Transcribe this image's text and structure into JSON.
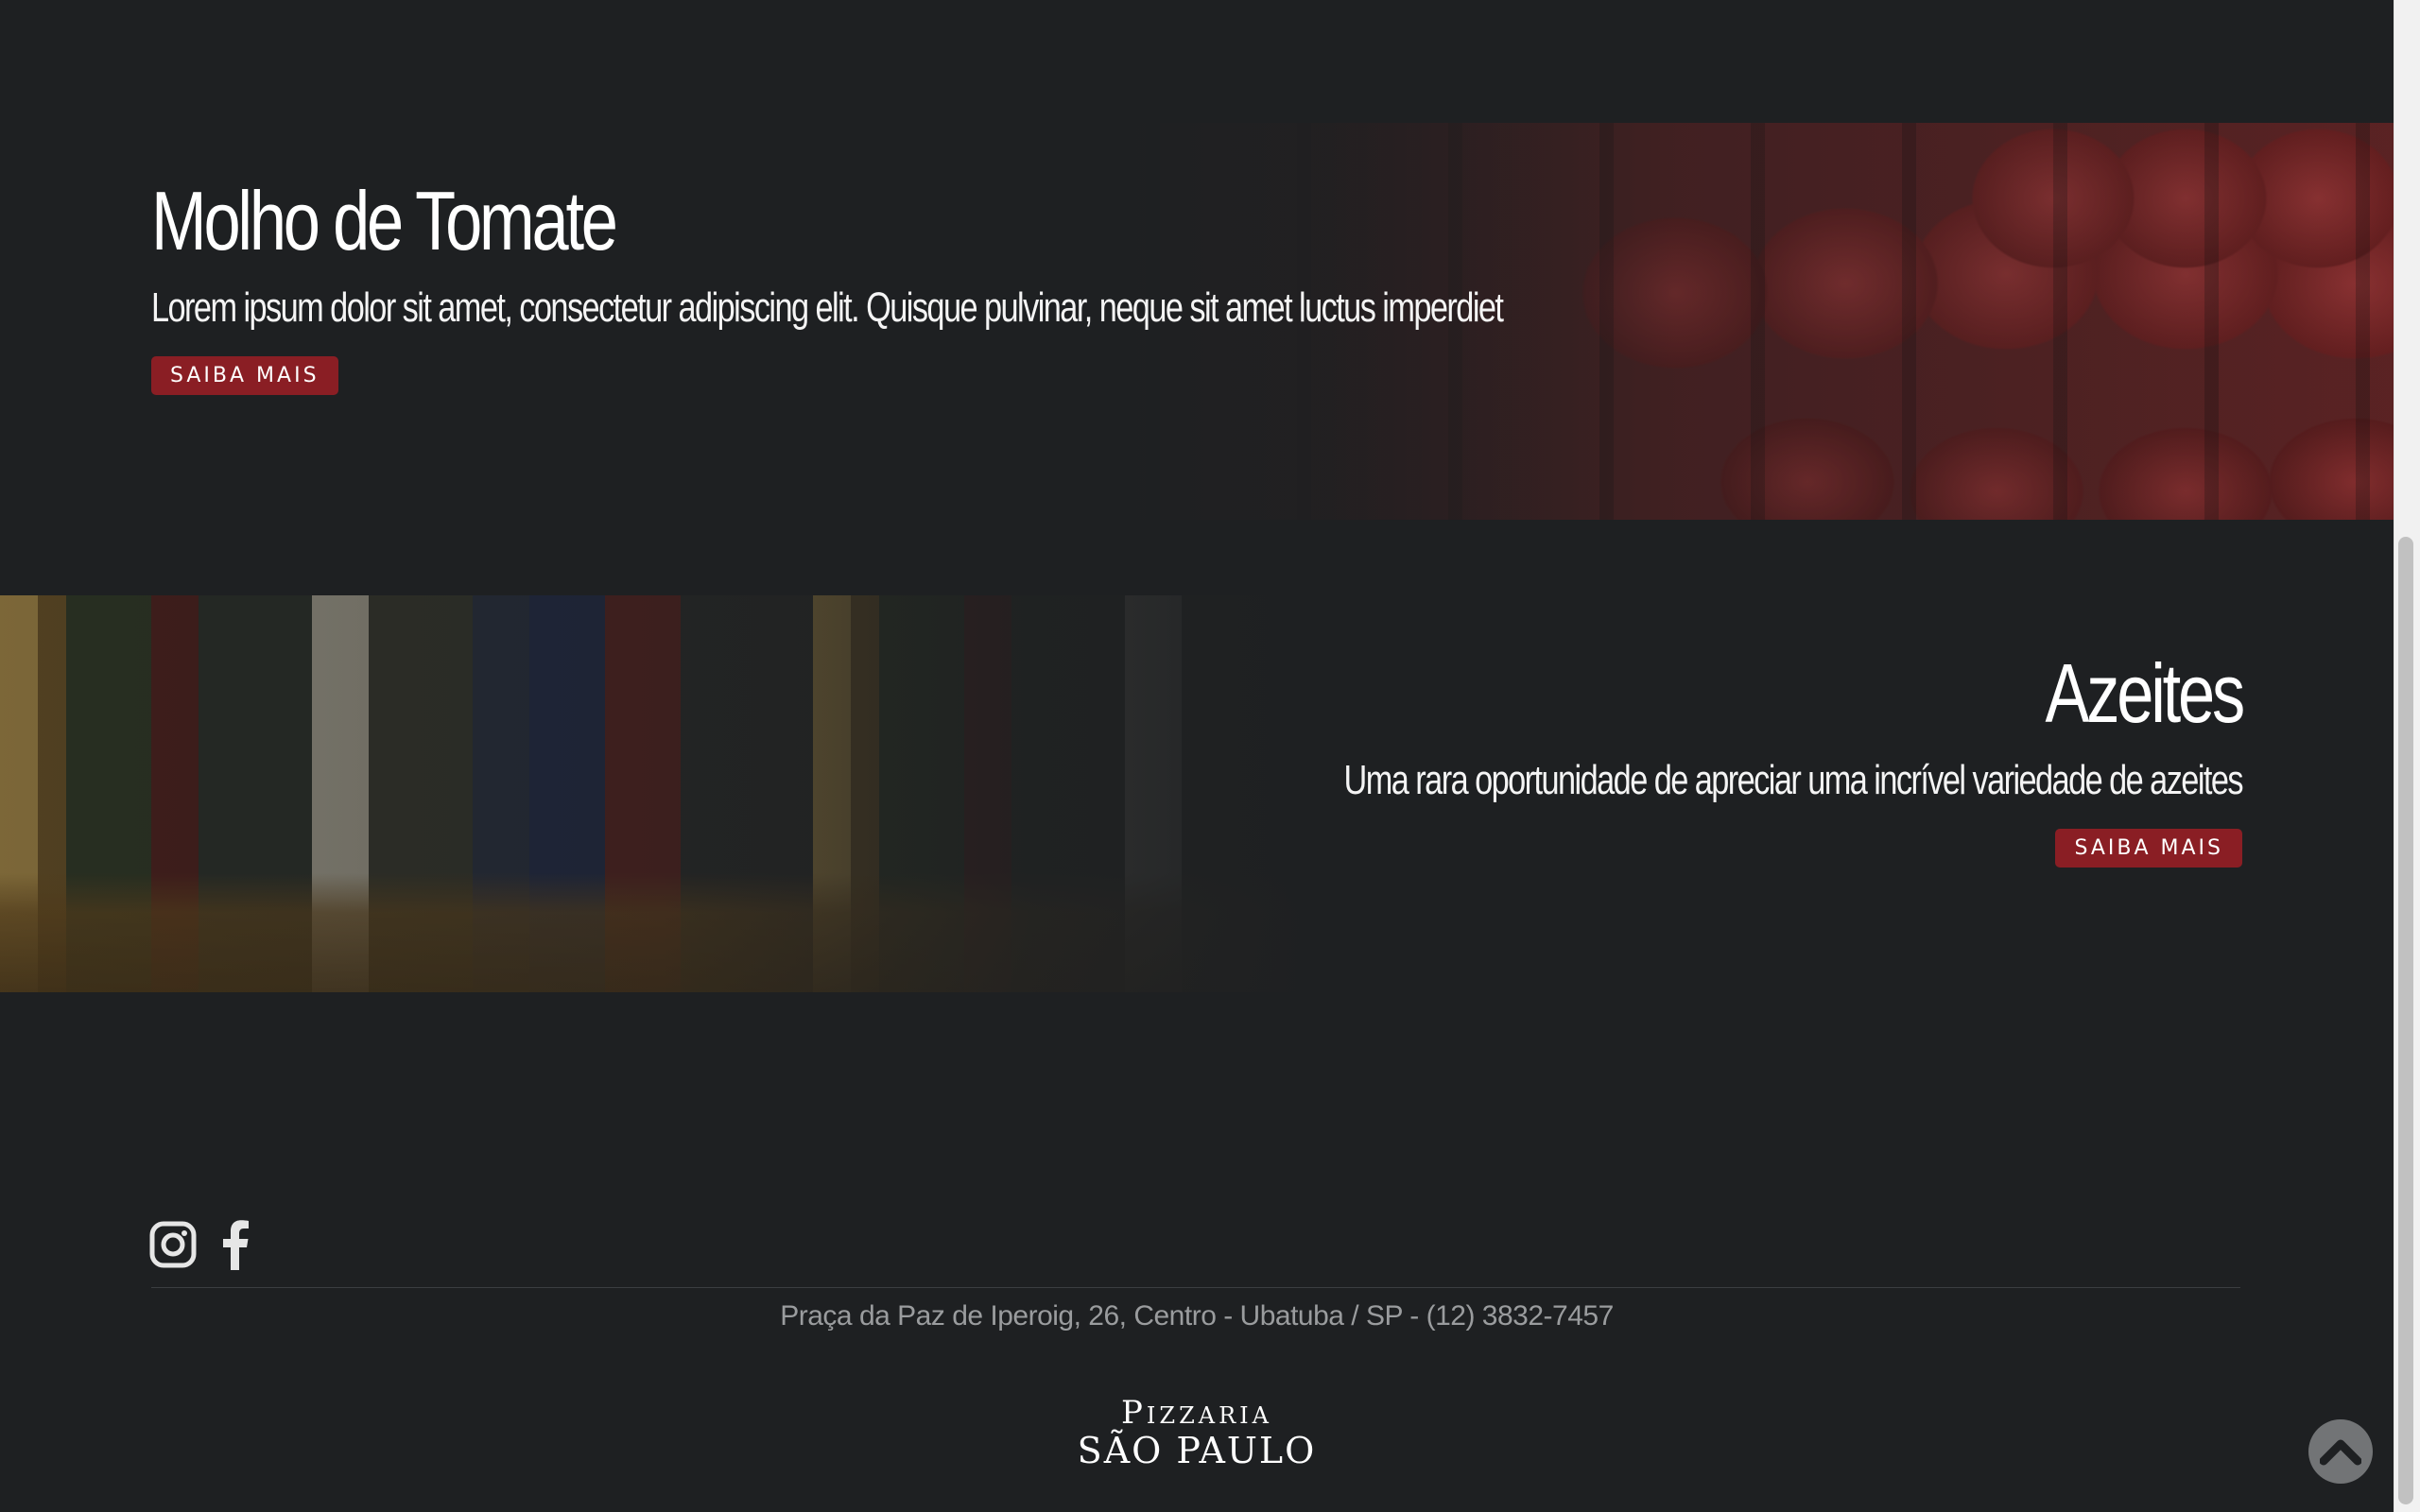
{
  "features": [
    {
      "title": "Molho de Tomate",
      "description": "Lorem ipsum dolor sit amet, consectetur adipiscing elit. Quisque pulvinar, neque sit amet luctus imperdiet",
      "button_label": "SAIBA MAIS",
      "image": "tomato-cans-photo"
    },
    {
      "title": "Azeites",
      "description": "Uma rara oportunidade de apreciar uma incrível variedade de azeites",
      "button_label": "SAIBA MAIS",
      "image": "olive-oil-bottles-photo"
    }
  ],
  "footer": {
    "social": [
      {
        "icon": "instagram-icon"
      },
      {
        "icon": "facebook-icon"
      }
    ],
    "address": "Praça da Paz de Iperoig, 26, Centro - Ubatuba / SP - (12) 3832-7457",
    "logo_top": "Pizzaria",
    "logo_bottom": "SÃO PAULO"
  },
  "colors": {
    "background": "#1e2022",
    "button": "#8a1e24",
    "address_text": "#9a9c9e"
  },
  "scroll_to_top_icon": "chevron-up-icon"
}
